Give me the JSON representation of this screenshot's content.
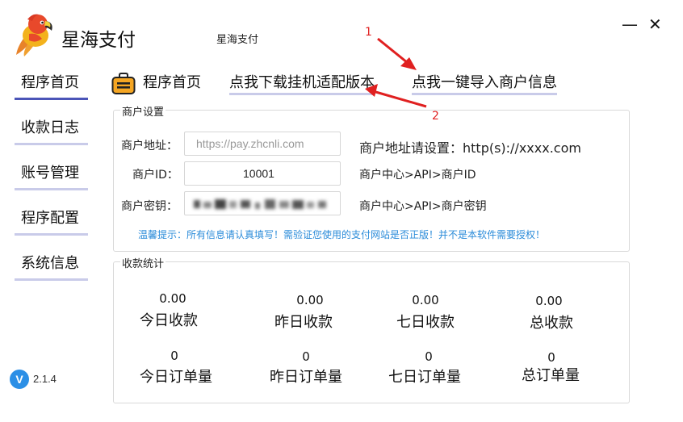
{
  "app": {
    "title": "星海支付",
    "subtitle": "星海支付",
    "logo_icon": "parrot-logo-icon",
    "minimize_glyph": "—",
    "close_glyph": "✕"
  },
  "sidebar": {
    "items": [
      {
        "label": "程序首页",
        "active": true
      },
      {
        "label": "收款日志",
        "active": false
      },
      {
        "label": "账号管理",
        "active": false
      },
      {
        "label": "程序配置",
        "active": false
      },
      {
        "label": "系统信息",
        "active": false
      }
    ]
  },
  "toolbar": {
    "home_label": "程序首页",
    "home_icon": "briefcase-icon",
    "download_label": "点我下载挂机适配版本",
    "import_label": "点我一键导入商户信息"
  },
  "annotations": {
    "arrow_1_label": "1",
    "arrow_2_label": "2",
    "arrow_color": "#e02020"
  },
  "merchant_settings": {
    "title": "商户设置",
    "address_label": "商户地址：",
    "address_placeholder": "https://pay.zhcnli.com",
    "address_hint": "商户地址请设置：http(s)://xxxx.com",
    "id_label": "商户ID：",
    "id_value": "10001",
    "id_hint": "商户中心>API>商户ID",
    "key_label": "商户密钥：",
    "key_hint": "商户中心>API>商户密钥",
    "warning": "温馨提示：所有信息请认真填写！需验证您使用的支付网站是否正版！并不是本软件需要授权！",
    "warning_color": "#2a8bd9"
  },
  "stats": {
    "title": "收款统计",
    "income": [
      {
        "value": "0.00",
        "label": "今日收款"
      },
      {
        "value": "0.00",
        "label": "昨日收款"
      },
      {
        "value": "0.00",
        "label": "七日收款"
      },
      {
        "value": "0.00",
        "label": "总收款"
      }
    ],
    "orders": [
      {
        "value": "0",
        "label": "今日订单量"
      },
      {
        "value": "0",
        "label": "昨日订单量"
      },
      {
        "value": "0",
        "label": "七日订单量"
      },
      {
        "value": "0",
        "label": "总订单量"
      }
    ]
  },
  "version": {
    "badge": "V",
    "text": "2.1.4"
  }
}
